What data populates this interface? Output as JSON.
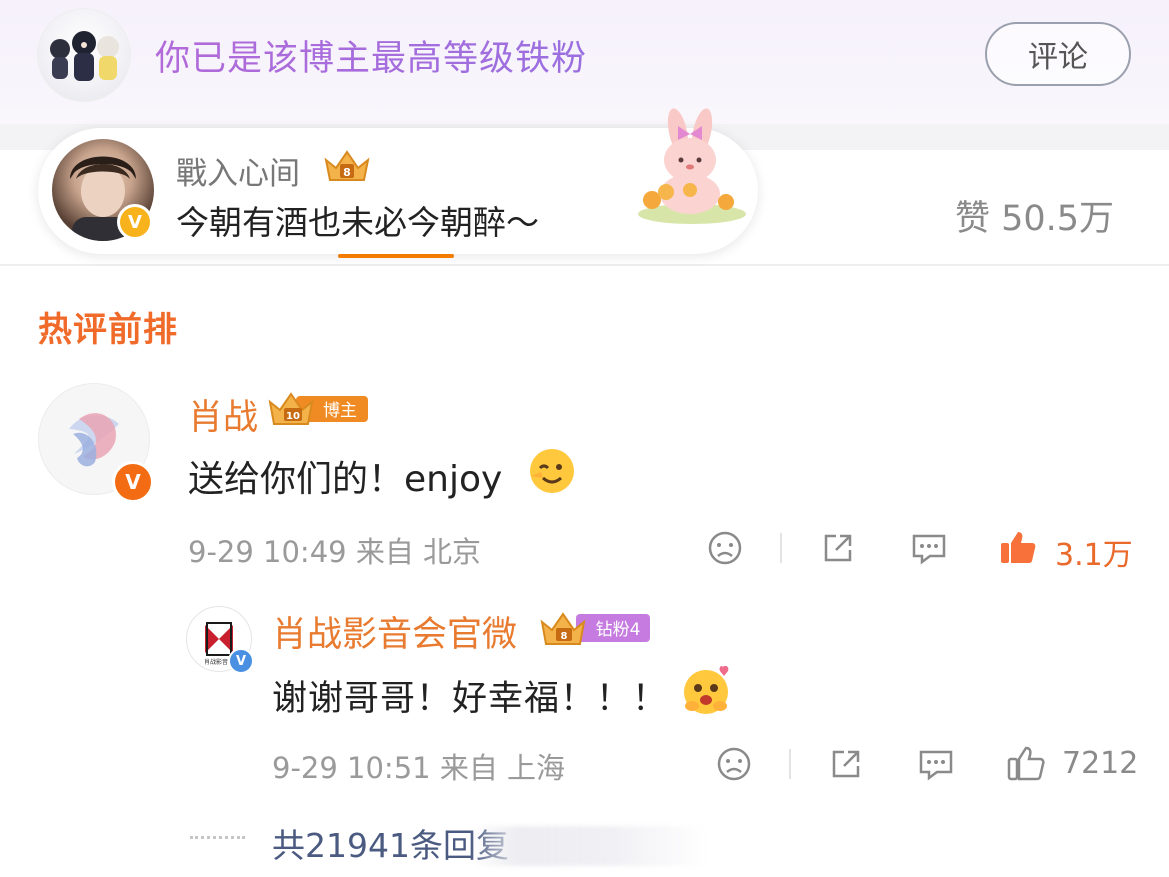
{
  "banner": {
    "text": "你已是该博主最高等级铁粉",
    "comment_button": "评论"
  },
  "stats": {
    "likes_total": "赞 50.5万"
  },
  "pinned_card": {
    "name": "戰入心间",
    "crown_level": "8",
    "text": "今朝有酒也未必今朝醉～"
  },
  "hot_section": {
    "title": "热评前排"
  },
  "comment": {
    "author": "肖战",
    "badge_level": "10",
    "badge_label": "博主",
    "text": "送给你们的！enjoy",
    "meta": "9-29 10:49 来自 北京",
    "likes": "3.1万",
    "liked": true
  },
  "reply": {
    "author": "肖战影音会官微",
    "badge_level": "8",
    "badge_label": "钻粉4",
    "text": "谢谢哥哥！好幸福！！！",
    "meta": "9-29 10:51 来自 上海",
    "likes": "7212",
    "avatar_logo_text": "肖战影音会"
  },
  "more_replies": {
    "text": "共21941条回复"
  },
  "colors": {
    "accent_orange": "#ff8200",
    "name_orange": "#e87b30",
    "banner_purple": "#b26ad9",
    "link_blue": "#4a5a80",
    "meta_gray": "#9a9a9a"
  },
  "icons": [
    "dislike-icon",
    "share-icon",
    "reply-icon",
    "like-icon",
    "crown-icon",
    "verified-icon"
  ]
}
